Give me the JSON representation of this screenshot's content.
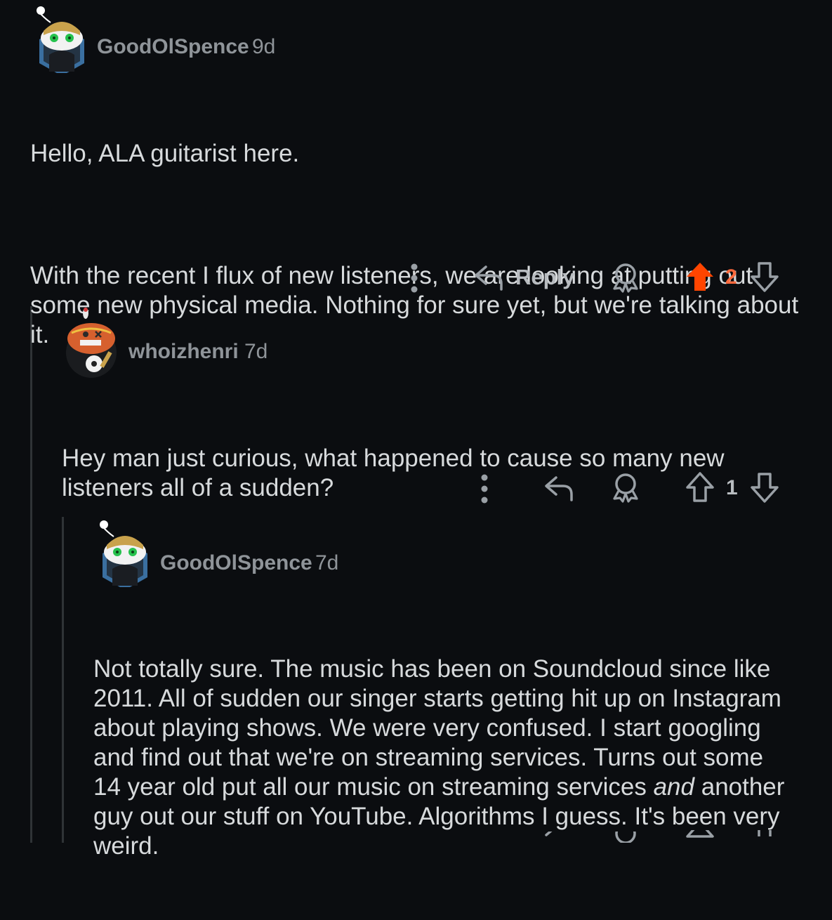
{
  "colors": {
    "background": "#0b0d10",
    "text": "#d7dadc",
    "muted": "#8f9499",
    "upvote_active": "#ff4500",
    "thread_line": "#2f3336"
  },
  "comments": [
    {
      "username": "GoodOlSpence",
      "age": "9d",
      "paragraphs": [
        "Hello, ALA guitarist here.",
        "With the recent I flux of new listeners, we are looking at putting out some new physical media. Nothing for sure yet, but we're talking about it."
      ],
      "actions": {
        "reply_label": "Reply",
        "votes": "2",
        "upvoted": true,
        "more_icon": "more-vertical-icon",
        "reply_icon": "reply-arrow-icon",
        "award_icon": "award-icon"
      }
    },
    {
      "username": "whoizhenri",
      "age": "7d",
      "paragraphs": [
        "Hey man just curious, what happened to cause so many new listeners all of a sudden?"
      ],
      "actions": {
        "votes": "1",
        "upvoted": false
      }
    },
    {
      "username": "GoodOlSpence",
      "age": "7d",
      "text_before_italic": "Not totally sure. The music has been on Soundcloud since like 2011. All of sudden our singer starts getting hit up on Instagram about playing shows. We were very confused. I start googling and find out that we're on streaming services. Turns out some 14 year old put all our music on streaming services ",
      "italic_word": "and",
      "text_after_italic": " another guy out our stuff on YouTube. Algorithms I guess. It's been very weird."
    }
  ]
}
